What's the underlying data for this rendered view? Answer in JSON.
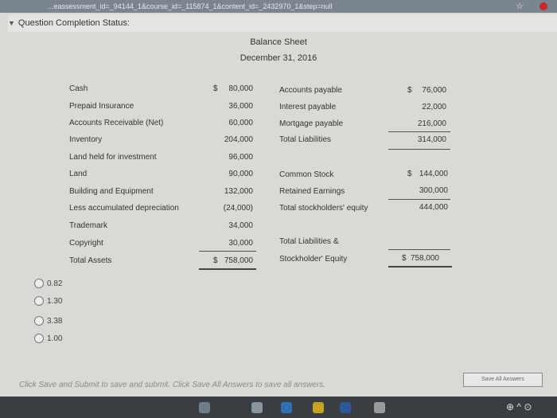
{
  "browser": {
    "url_fragment": "...eassessment_id=_94144_1&course_id=_115874_1&content_id=_2432970_1&step=null",
    "star_glyph": "☆"
  },
  "status_header": {
    "label": "Question Completion Status:"
  },
  "balance_sheet": {
    "title": "Balance Sheet",
    "date": "December 31, 2016",
    "assets": [
      {
        "label": "Cash",
        "currency": "$",
        "value": "80,000"
      },
      {
        "label": "Prepaid Insurance",
        "value": "36,000"
      },
      {
        "label": "Accounts Receivable (Net)",
        "value": "60,000"
      },
      {
        "label": "Inventory",
        "value": "204,000"
      },
      {
        "label": "Land held for investment",
        "value": "96,000"
      },
      {
        "label": "Land",
        "value": "90,000"
      },
      {
        "label": "Building and Equipment",
        "value": "132,000"
      },
      {
        "label": "Less accumulated depreciation",
        "value": "(24,000)"
      },
      {
        "label": "Trademark",
        "value": "34,000"
      },
      {
        "label": "Copyright",
        "value": "30,000"
      },
      {
        "label": "Total Assets",
        "currency": "$",
        "value": "758,000"
      }
    ],
    "liabilities": [
      {
        "label": "Accounts payable",
        "currency": "$",
        "value": "76,000"
      },
      {
        "label": "Interest payable",
        "value": "22,000"
      },
      {
        "label": "Mortgage payable",
        "value": "216,000"
      },
      {
        "label": "Total Liabilities",
        "value": "314,000"
      }
    ],
    "equity": [
      {
        "label": "Common Stock",
        "currency": "$",
        "value": "144,000"
      },
      {
        "label": "Retained Earnings",
        "value": "300,000"
      },
      {
        "label": "Total stockholders' equity",
        "value": "444,000"
      }
    ],
    "total_liab_equity": {
      "label_line1": "Total Liabilities &",
      "label_line2": "Stockholder' Equity",
      "currency": "$",
      "value": "758,000"
    }
  },
  "answer_choices": [
    {
      "label": "0.82"
    },
    {
      "label": "1.30"
    },
    {
      "label": "3.38"
    },
    {
      "label": "1.00"
    }
  ],
  "footer": {
    "note": "Click Save and Submit to save and submit. Click Save All Answers to save all answers.",
    "save_all_label": "Save All Answers"
  },
  "taskbar": {
    "tray_glyphs": "⊕ ^ ⊙"
  }
}
